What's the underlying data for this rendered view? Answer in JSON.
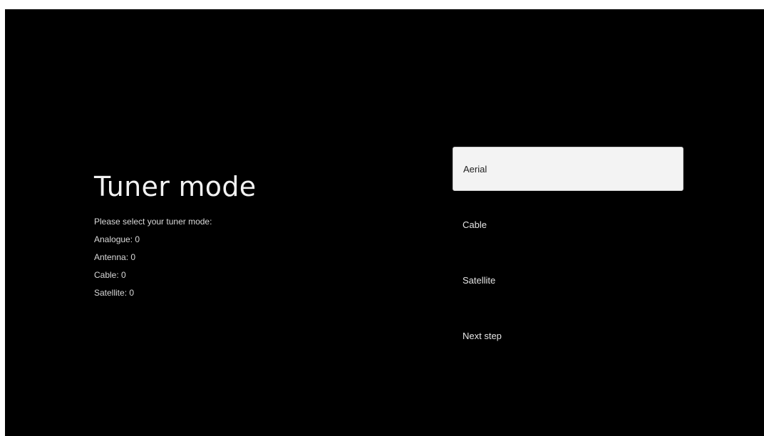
{
  "page": {
    "title": "Tuner mode",
    "prompt": "Please select your tuner mode:",
    "counts": [
      {
        "text": "Analogue: 0"
      },
      {
        "text": "Antenna: 0"
      },
      {
        "text": "Cable: 0"
      },
      {
        "text": "Satellite: 0"
      }
    ]
  },
  "options": [
    {
      "label": "Aerial",
      "selected": true
    },
    {
      "label": "Cable",
      "selected": false
    },
    {
      "label": "Satellite",
      "selected": false
    },
    {
      "label": "Next step",
      "selected": false
    }
  ],
  "colors": {
    "background": "#000000",
    "selected_background": "#f3f3f3",
    "text": "#ffffff"
  }
}
